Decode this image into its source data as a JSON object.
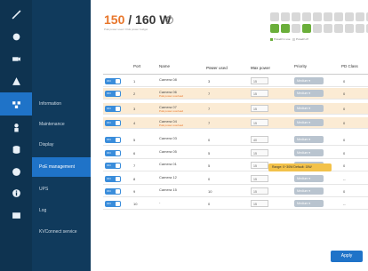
{
  "rail": [
    "signal-icon",
    "gear-icon",
    "camera-icon",
    "warning-icon",
    "network-icon",
    "person-icon",
    "database-icon",
    "globe-icon",
    "info-icon",
    "building-icon"
  ],
  "subnav": {
    "items": [
      "Information",
      "Maintenance",
      "Display",
      "PoE management",
      "UPS",
      "Log",
      "KVConnect service"
    ],
    "active": 3
  },
  "power": {
    "used": "150",
    "total": "/ 160 W",
    "subtitle": "PoE power used / PoE power budget"
  },
  "legend": {
    "active": "PoweR in use",
    "inactive": "PoweR off"
  },
  "ports_on": [
    0,
    0,
    0,
    0,
    0,
    0,
    0,
    0,
    0,
    0,
    1,
    1,
    0,
    1,
    0,
    0,
    0,
    0,
    0,
    0
  ],
  "table": {
    "headers": {
      "port": "Port",
      "name": "Name",
      "power_used": "Power used",
      "power_used_sub": "(Watt)",
      "max_power": "Max power",
      "max_power_sub": "(Watt)",
      "priority": "Priority",
      "pd_class": "PD Class"
    },
    "toggle_label": "ON",
    "rows": [
      {
        "port": "1",
        "name": "Camera 08",
        "warn": "",
        "used": "3",
        "max": "15",
        "priority": "Medium",
        "pd": "0"
      },
      {
        "port": "2",
        "name": "Camera 06",
        "warn": "PoE power overload",
        "used": "7",
        "max": "15",
        "priority": "Medium",
        "pd": "0"
      },
      {
        "port": "3",
        "name": "Camera 07",
        "warn": "PoE power overload",
        "used": "7",
        "max": "15",
        "priority": "Medium",
        "pd": "0"
      },
      {
        "port": "4",
        "name": "Camera 04",
        "warn": "PoE power overload",
        "used": "7",
        "max": "15",
        "priority": "Medium",
        "pd": "0"
      },
      {
        "port": "5",
        "name": "Camera 03",
        "warn": "",
        "used": "0",
        "max": "40",
        "priority": "Medium",
        "pd": "0"
      },
      {
        "port": "6",
        "name": "Camera 05",
        "warn": "",
        "used": "5",
        "max": "15",
        "priority": "Medium",
        "pd": "0"
      },
      {
        "port": "7",
        "name": "Camera 01",
        "warn": "5",
        "used": "5",
        "max": "15",
        "priority": "Medium",
        "pd": "0"
      },
      {
        "port": "8",
        "name": "Camera 12",
        "warn": "",
        "used": "0",
        "max": "15",
        "priority": "Medium",
        "pd": "--"
      },
      {
        "port": "9",
        "name": "Camera 15",
        "warn": "",
        "used": "10",
        "max": "15",
        "priority": "Medium",
        "pd": "0"
      },
      {
        "port": "10",
        "name": "-",
        "warn": "",
        "used": "0",
        "max": "15",
        "priority": "Medium",
        "pd": "--"
      }
    ]
  },
  "tooltip": "Range: 0~30W Default: 15W",
  "apply_label": "Apply"
}
